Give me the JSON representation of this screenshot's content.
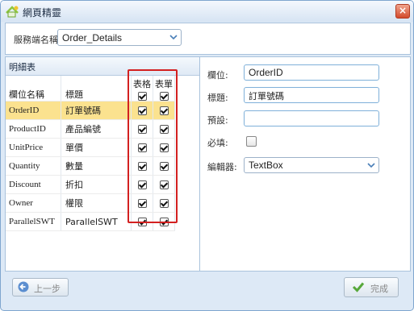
{
  "window": {
    "title": "網頁精靈",
    "close_glyph": "×"
  },
  "service": {
    "label": "服務端名稱",
    "value": "Order_Details"
  },
  "detail_table": {
    "title": "明細表",
    "headers": {
      "field": "欄位名稱",
      "caption": "標題",
      "grid": "表格",
      "form": "表單"
    },
    "rows": [
      {
        "field": "OrderID",
        "caption": "訂單號碼",
        "grid": true,
        "form": true,
        "selected": true
      },
      {
        "field": "ProductID",
        "caption": "產品編號",
        "grid": true,
        "form": true
      },
      {
        "field": "UnitPrice",
        "caption": "單價",
        "grid": true,
        "form": true
      },
      {
        "field": "Quantity",
        "caption": "數量",
        "grid": true,
        "form": true
      },
      {
        "field": "Discount",
        "caption": "折扣",
        "grid": true,
        "form": true
      },
      {
        "field": "Owner",
        "caption": "權限",
        "grid": true,
        "form": true
      },
      {
        "field": "ParallelSWT",
        "caption": "ParallelSWT",
        "grid": true,
        "form": true
      }
    ]
  },
  "properties": {
    "field_label": "欄位:",
    "field_value": "OrderID",
    "caption_label": "標題:",
    "caption_value": "訂單號碼",
    "default_label": "預設:",
    "default_value": "",
    "required_label": "必填:",
    "required_checked": false,
    "editor_label": "編輯器:",
    "editor_value": "TextBox"
  },
  "footer": {
    "prev_label": "上一步",
    "done_label": "完成"
  },
  "colors": {
    "selected_row": "#fbe28f",
    "highlight_box": "#d32020",
    "border": "#a9c2dc"
  }
}
